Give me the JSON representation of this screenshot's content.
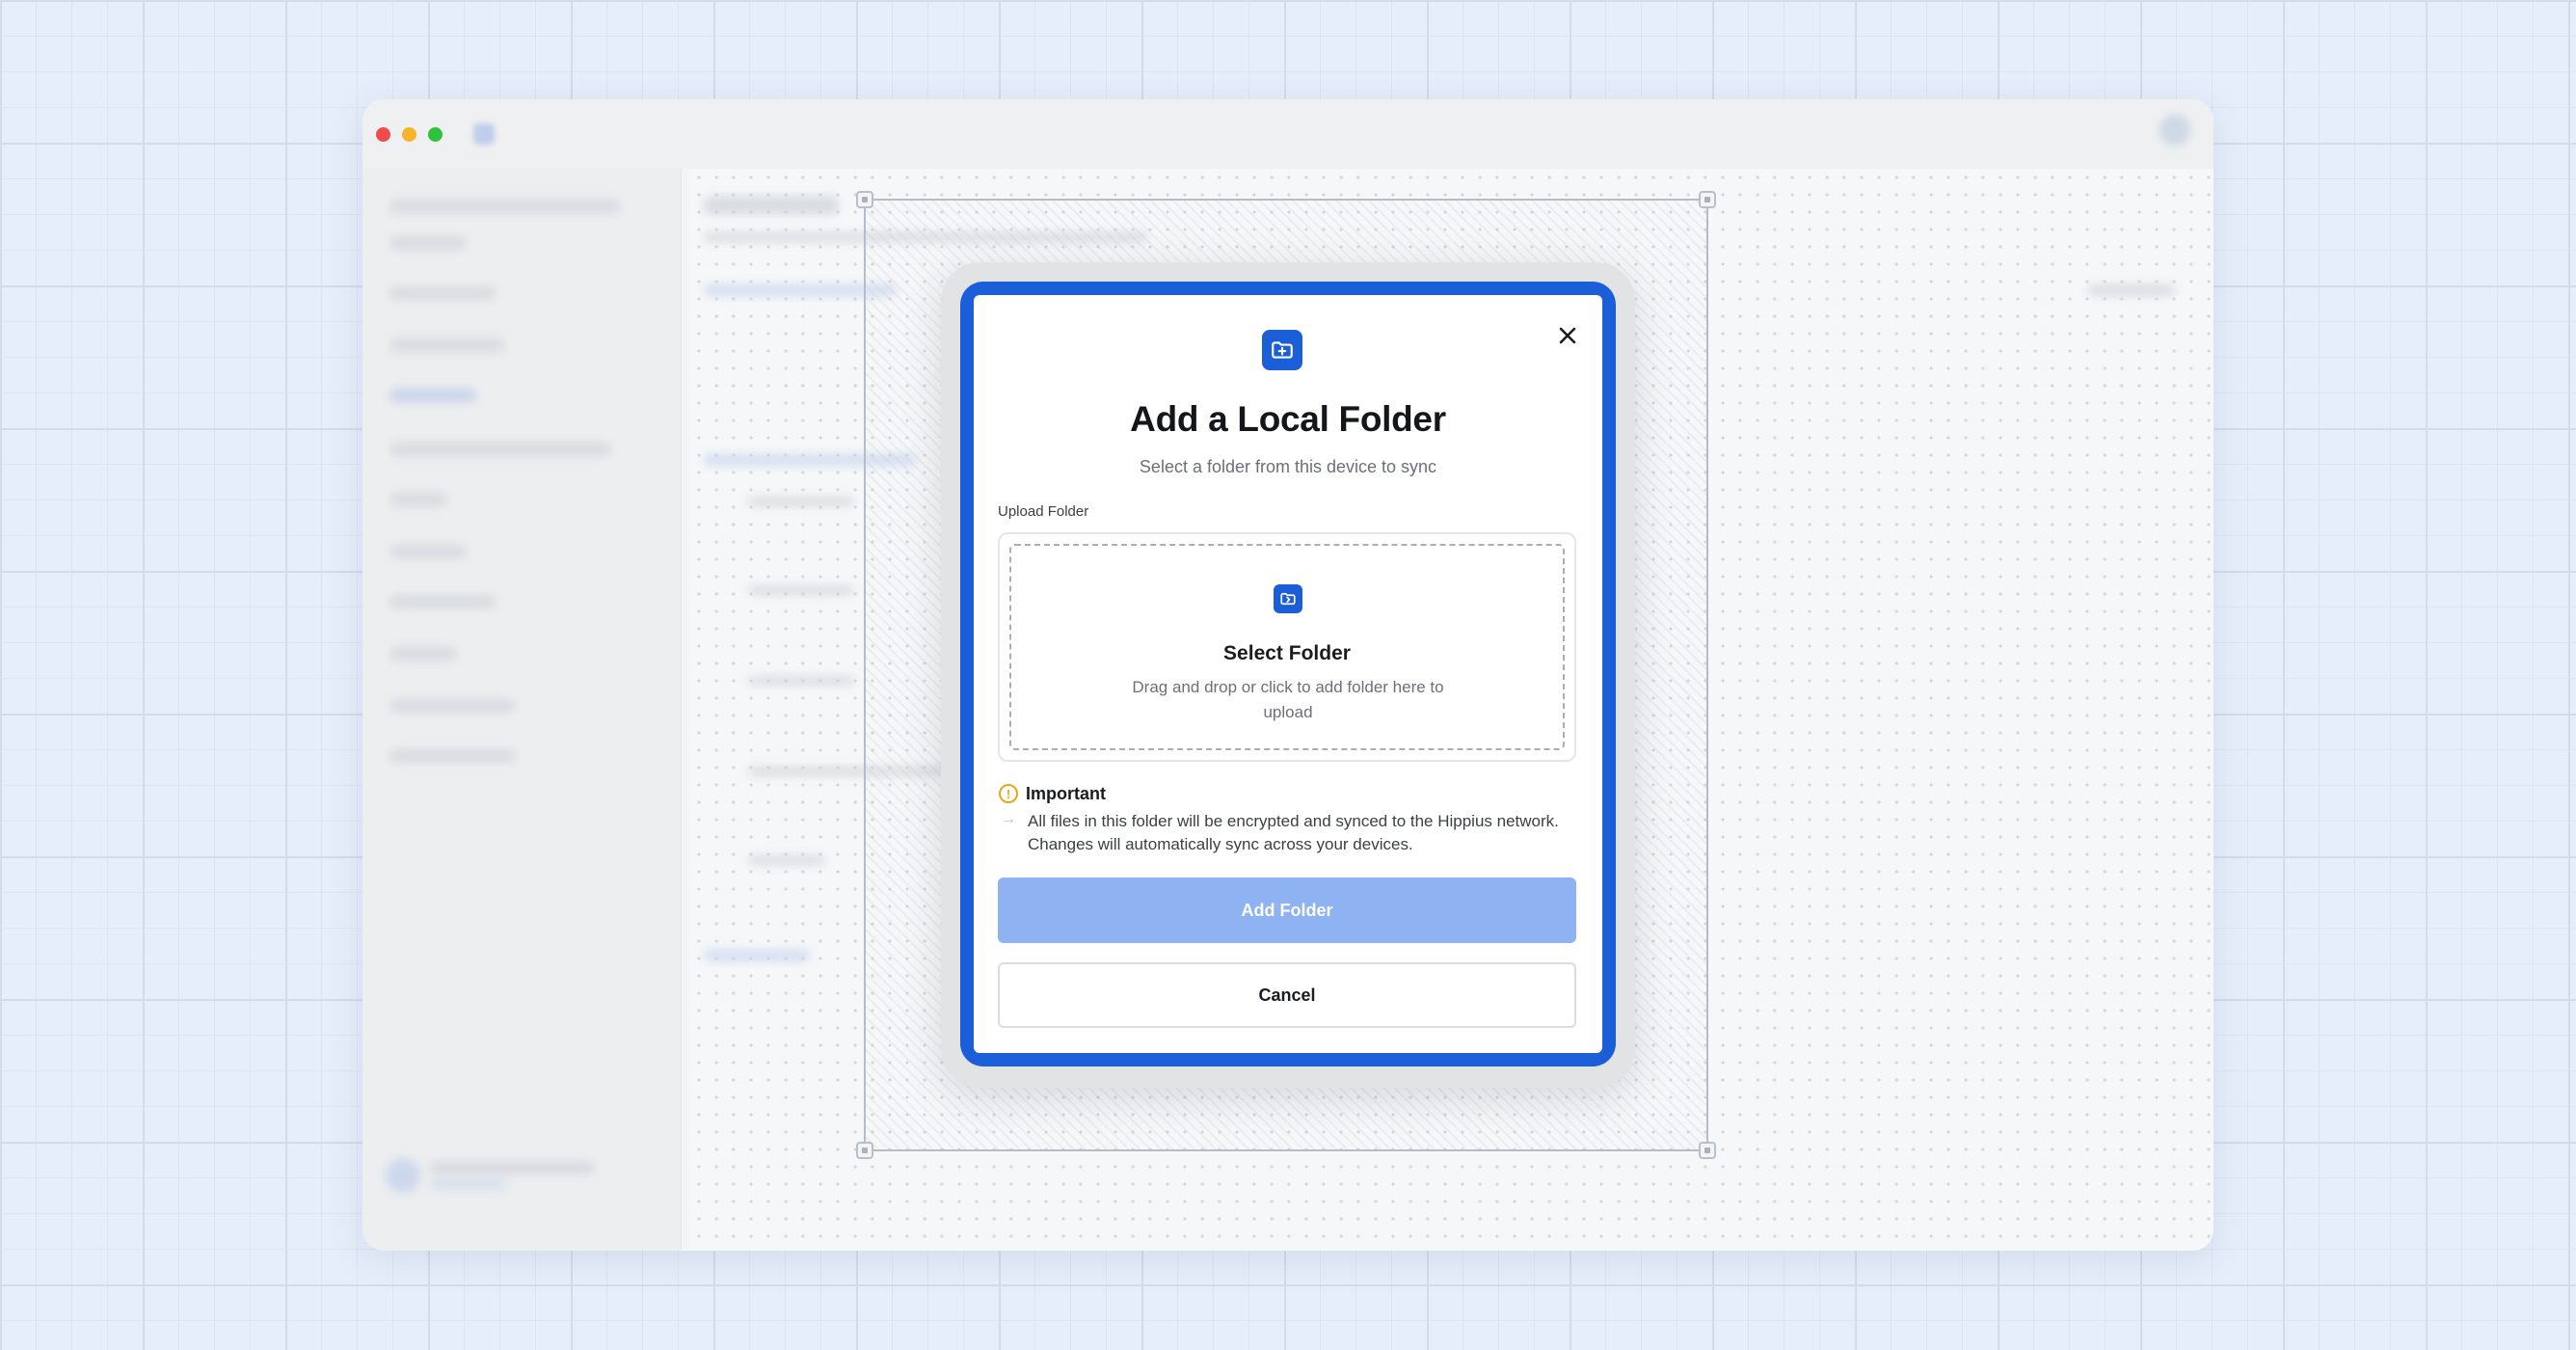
{
  "colors": {
    "accent": "#1a5ed8",
    "primary_button_disabled": "#8fb2f2",
    "warning": "#e6a817",
    "canvas_background": "#e6eefb"
  },
  "window": {
    "traffic_lights": [
      "close",
      "minimize",
      "zoom"
    ]
  },
  "modal": {
    "header_icon": "folder-plus-icon",
    "close_icon": "close-icon",
    "title": "Add a Local Folder",
    "subtitle": "Select a folder from this device to sync",
    "upload": {
      "label": "Upload Folder",
      "icon": "folder-upload-icon",
      "title": "Select Folder",
      "description": "Drag and drop or click to add folder here to upload"
    },
    "notice": {
      "icon": "warning-circle-icon",
      "title": "Important",
      "text": "All files in this folder will be encrypted and synced to the Hippius network. Changes will automatically sync across your devices."
    },
    "primary_button": {
      "label": "Add Folder",
      "state": "disabled"
    },
    "secondary_button": {
      "label": "Cancel"
    }
  }
}
